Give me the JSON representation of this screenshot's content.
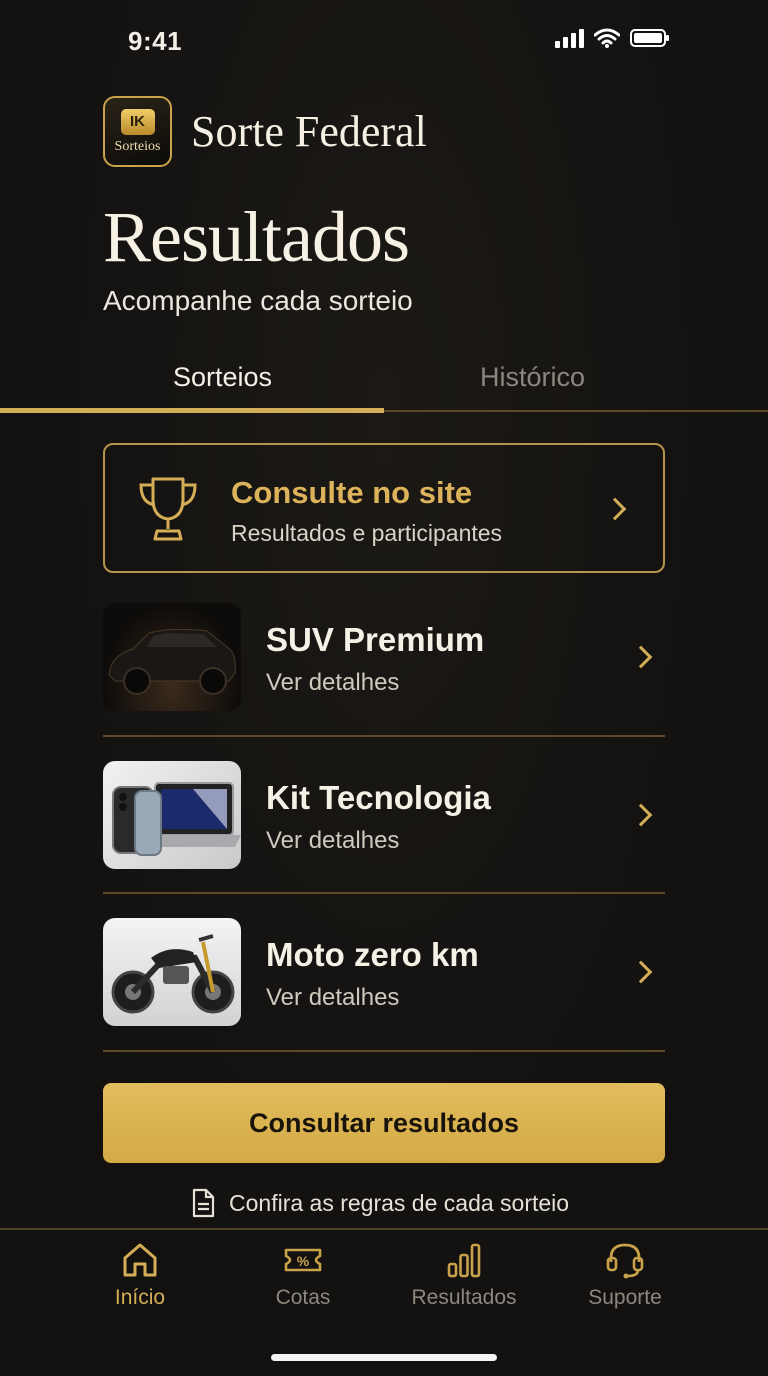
{
  "status_bar": {
    "time": "9:41"
  },
  "brand": {
    "badge_text": "Sorteios",
    "badge_mark": "IK",
    "name": "Sorte Federal"
  },
  "page": {
    "title": "Resultados",
    "subtitle": "Acompanhe cada sorteio"
  },
  "tabs": [
    {
      "label": "Sorteios",
      "active": true
    },
    {
      "label": "Histórico",
      "active": false
    }
  ],
  "highlight": {
    "icon": "trophy-icon",
    "title": "Consulte no site",
    "subtitle": "Resultados e participantes"
  },
  "items": [
    {
      "title": "SUV Premium",
      "subtitle": "Ver detalhes",
      "image": "suv-image"
    },
    {
      "title": "Kit Tecnologia",
      "subtitle": "Ver detalhes",
      "image": "tech-kit-image"
    },
    {
      "title": "Moto zero km",
      "subtitle": "Ver detalhes",
      "image": "motorcycle-image"
    }
  ],
  "actions": {
    "primary": "Consultar resultados",
    "rules": "Confira as regras de cada sorteio"
  },
  "nav": [
    {
      "label": "Início",
      "icon": "home-icon",
      "active": true
    },
    {
      "label": "Cotas",
      "icon": "ticket-icon",
      "active": false
    },
    {
      "label": "Resultados",
      "icon": "bar-chart-icon",
      "active": false
    },
    {
      "label": "Suporte",
      "icon": "headset-icon",
      "active": false
    }
  ],
  "colors": {
    "accent": "#d4ae57",
    "background": "#141210",
    "text": "#f3efe6",
    "muted": "#8d877d"
  }
}
